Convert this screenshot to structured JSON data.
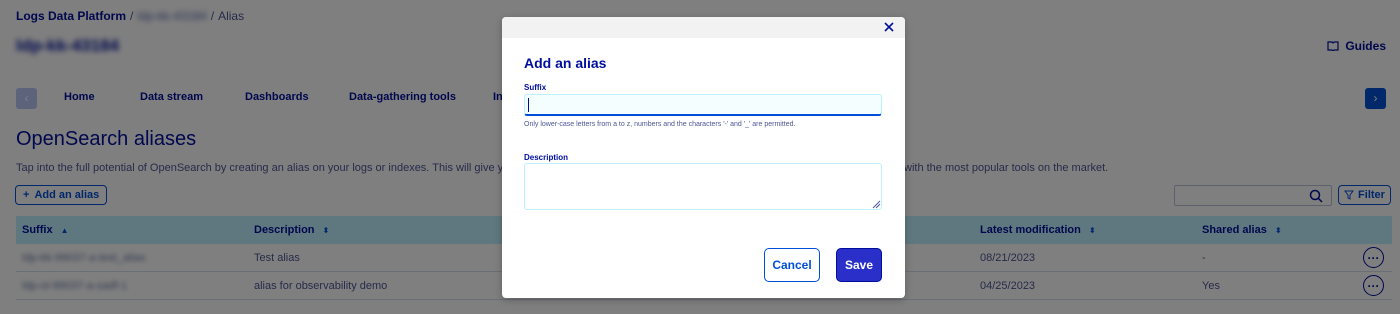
{
  "breadcrumb": {
    "root": "Logs Data Platform",
    "sep1": "/",
    "project": "ldp-kk-43184",
    "sep2": "/",
    "current": "Alias"
  },
  "project_title": "ldp-kk-43184",
  "guides_label": "Guides",
  "tabs": [
    {
      "label": "Home"
    },
    {
      "label": "Data stream"
    },
    {
      "label": "Dashboards"
    },
    {
      "label": "Data-gathering tools"
    },
    {
      "label": "In"
    }
  ],
  "section_title": "OpenSearch aliases",
  "intro_text": "Tap into the full potential of OpenSearch by creating an alias on your logs or indexes. This will give you acce",
  "intro_tail": "with the most popular tools on the market.",
  "add_alias_label": "Add an alias",
  "filter_label": "Filter",
  "table": {
    "headers": {
      "suffix": "Suffix",
      "description": "Description",
      "latest_modification": "Latest modification",
      "shared_alias": "Shared alias"
    },
    "rows": [
      {
        "suffix": "ldp-kk-99037-a-test_alias",
        "description": "Test alias",
        "latest_modification": "08/21/2023",
        "shared_alias": "-"
      },
      {
        "suffix": "ldp-ol-99037-a-sadf-1",
        "description": "alias for observability demo",
        "latest_modification": "04/25/2023",
        "shared_alias": "Yes"
      }
    ]
  },
  "modal": {
    "title": "Add an alias",
    "suffix_label": "Suffix",
    "suffix_value": "",
    "hint": "Only lower-case letters from a to z, numbers and the characters '-' and '_' are permitted.",
    "description_label": "Description",
    "description_value": "",
    "cancel_label": "Cancel",
    "save_label": "Save"
  },
  "colors": {
    "primary": "#0050d7",
    "navy": "#000e9c",
    "table_header_bg": "#bef1ff",
    "save_bg": "#2a2fc9"
  }
}
